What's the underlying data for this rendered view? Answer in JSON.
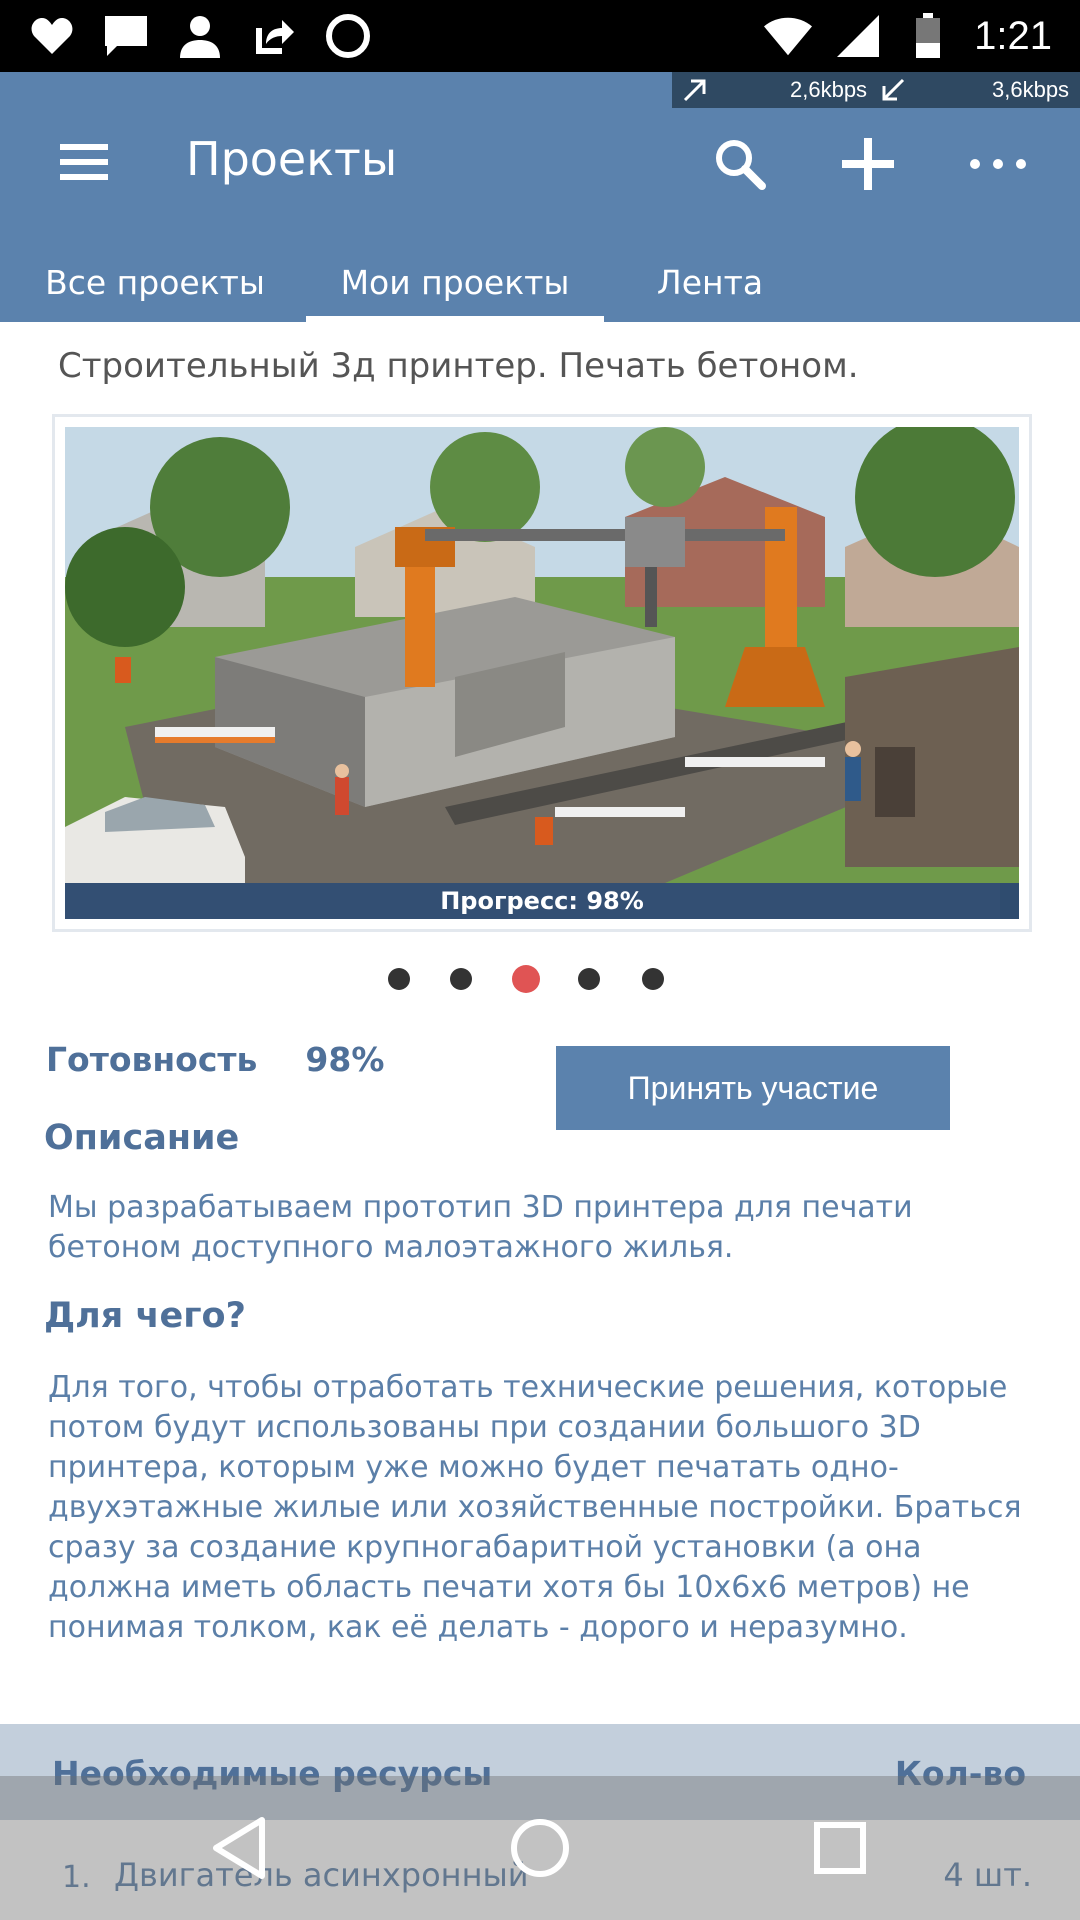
{
  "status_bar": {
    "time": "1:21",
    "left_icons": [
      "heart-icon",
      "message-icon",
      "person-icon",
      "share-out-icon",
      "circle-icon"
    ],
    "right_icons": [
      "wifi-icon",
      "signal-icon",
      "battery-icon"
    ]
  },
  "network": {
    "upload": "2,6kbps",
    "download": "3,6kbps"
  },
  "app_bar": {
    "title": "Проекты",
    "actions": [
      "search-icon",
      "add-icon",
      "more-icon"
    ]
  },
  "tabs": [
    {
      "label": "Все проекты",
      "active": false
    },
    {
      "label": "Мои проекты",
      "active": true
    },
    {
      "label": "Лента",
      "active": false
    }
  ],
  "project": {
    "title": "Строительный 3д принтер. Печать бетоном.",
    "progress_label": "Прогресс: 98%",
    "progress_value": 0.98,
    "slides_total": 5,
    "slide_active_index": 2,
    "readiness_label": "Готовность",
    "readiness_value": "98%",
    "join_button": "Принять участие",
    "description_heading": "Описание",
    "description_text": "Мы разрабатываем прототип 3D принтера для печати бетоном доступного малоэтажного жилья.",
    "purpose_heading": "Для чего?",
    "purpose_text": "Для того, чтобы отработать технические решения, которые потом будут использованы при создании большого 3D принтера, которым уже можно будет печатать одно- двухэтажные жилые или хозяйственные постройки. Браться сразу за создание крупногабаритной установки (а она должна иметь область печати хотя бы 10х6х6 метров) не понимая толком, как её делать - дорого и неразумно."
  },
  "resources": {
    "header_name": "Необходимые ресурсы",
    "header_qty": "Кол-во",
    "rows": [
      {
        "num": "1.",
        "name": "Двигатель асинхронный",
        "qty": "4 шт."
      }
    ]
  },
  "nav_bar": {
    "buttons": [
      "back-icon",
      "home-icon",
      "recents-icon"
    ]
  },
  "colors": {
    "app_bar": "#5b82ad",
    "text_blue": "#4f7099",
    "dot_active": "#e05454",
    "progress_strip": "#2f4c6f"
  }
}
